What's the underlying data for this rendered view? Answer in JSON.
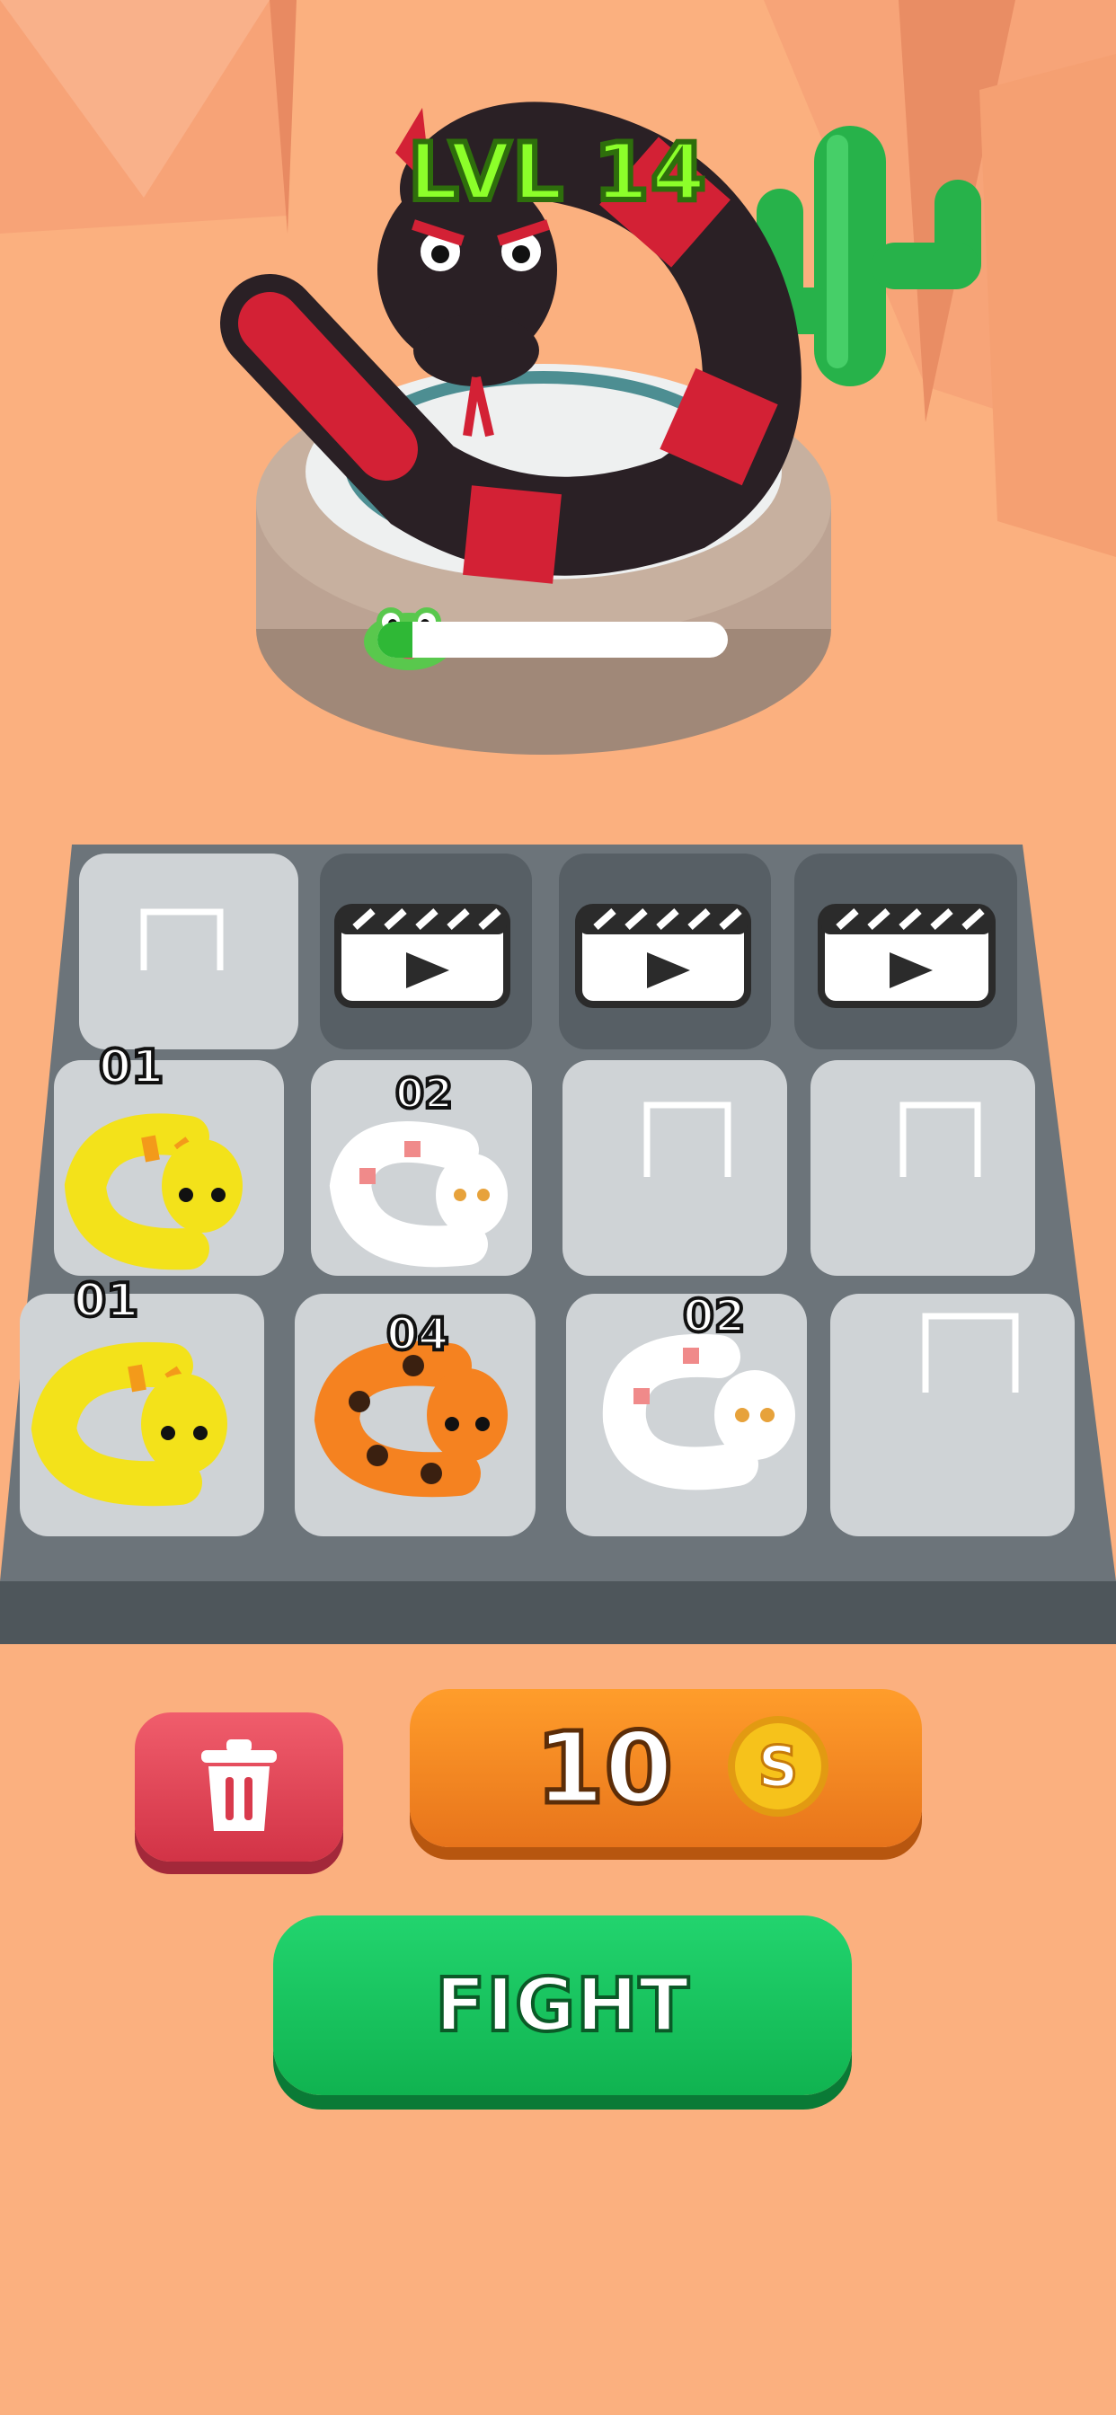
{
  "level": {
    "label": "LVL 14"
  },
  "boss": {
    "health_progress": 0.1,
    "icon": "frog-face-icon"
  },
  "board": {
    "locked_slots": [
      {
        "name": "locked-slot-1",
        "icon": "video-ad-icon"
      },
      {
        "name": "locked-slot-2",
        "icon": "video-ad-icon"
      },
      {
        "name": "locked-slot-3",
        "icon": "video-ad-icon"
      }
    ],
    "snakes": [
      {
        "name": "snake-yellow-r1c1",
        "level": "01",
        "color": "#f3e21a",
        "stripe": "#f39a1a"
      },
      {
        "name": "snake-white-r1c2",
        "level": "02",
        "color": "#ffffff",
        "stripe": "#f08a8a"
      },
      {
        "name": "snake-yellow-r2c1",
        "level": "01",
        "color": "#f3e21a",
        "stripe": "#f39a1a"
      },
      {
        "name": "snake-orange-r2c2",
        "level": "04",
        "color": "#f58220",
        "stripe": "#3a2010"
      },
      {
        "name": "snake-white-r2c3",
        "level": "02",
        "color": "#ffffff",
        "stripe": "#f08a8a"
      }
    ]
  },
  "controls": {
    "delete_icon": "trash-icon",
    "buy_price": "10",
    "coin_symbol": "S",
    "fight_label": "FIGHT"
  },
  "colors": {
    "background": "#fbb07f",
    "board": "#5f676e",
    "slot": "#c9cdd0",
    "boss_body": "#2a2025",
    "boss_stripe": "#d32135"
  }
}
